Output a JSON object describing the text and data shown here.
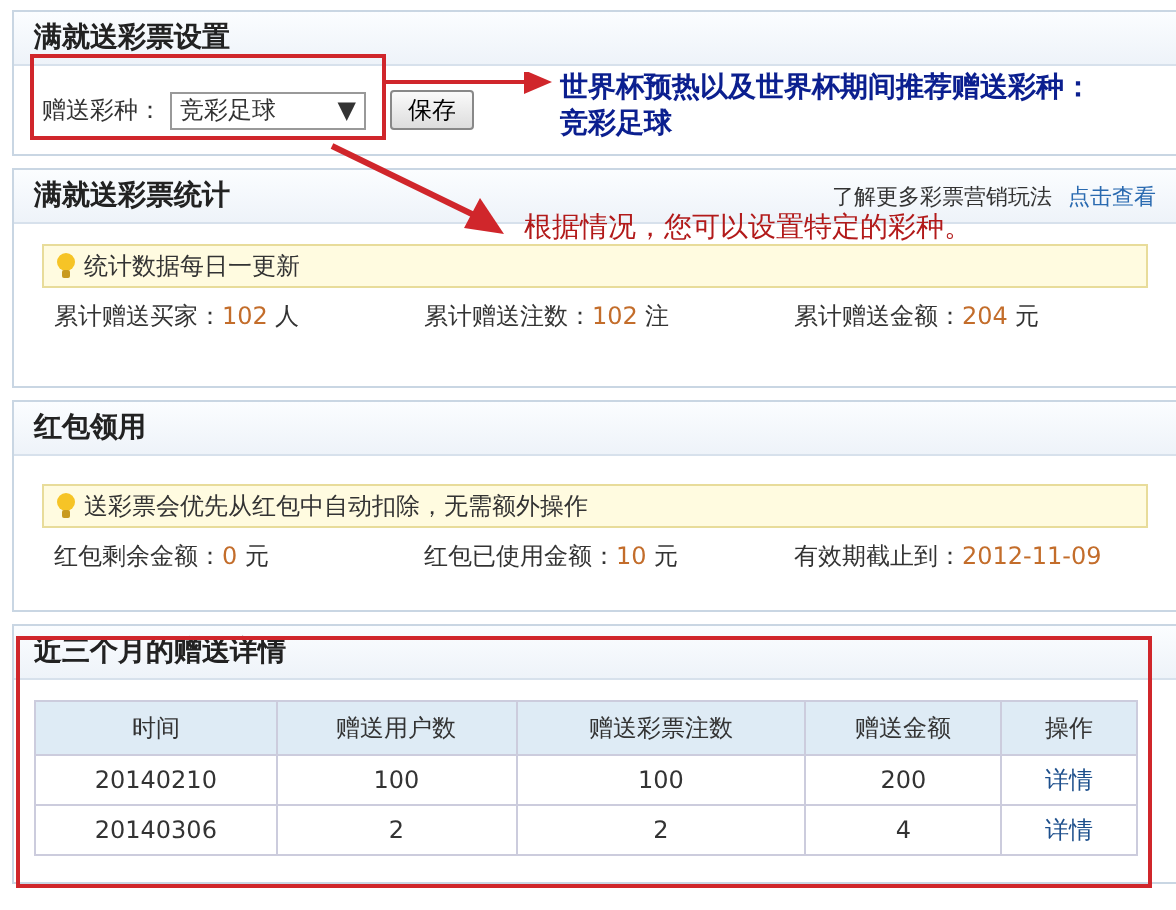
{
  "panels": [
    {
      "title": "满就送彩票设置",
      "kind": "setting",
      "field_label": "赠送彩种：",
      "select_value": "竞彩足球",
      "select_caret": "▼",
      "button": "保存"
    },
    {
      "title": "满就送彩票统计",
      "kind": "stats",
      "link_prefix": "了解更多彩票营销玩法",
      "link": "点击查看",
      "tip": "统计数据每日一更新",
      "stats": [
        {
          "label": "累计赠送买家：",
          "value": "102",
          "unit": "人"
        },
        {
          "label": "累计赠送注数：",
          "value": "102",
          "unit": "注"
        },
        {
          "label": "累计赠送金额：",
          "value": "204",
          "unit": "元"
        }
      ]
    },
    {
      "title": "红包领用",
      "kind": "stats",
      "tip": "送彩票会优先从红包中自动扣除，无需额外操作",
      "stats": [
        {
          "label": "红包剩余金额：",
          "value": "0",
          "unit": "元"
        },
        {
          "label": "红包已使用金额：",
          "value": "10",
          "unit": "元"
        },
        {
          "label": "有效期截止到：",
          "value": "2012-11-09"
        }
      ]
    },
    {
      "title": "近三个月的赠送详情",
      "kind": "table",
      "highlighted": true,
      "columns": [
        "时间",
        "赠送用户数",
        "赠送彩票注数",
        "赠送金额",
        "操作"
      ],
      "rows": [
        {
          "cells": [
            "20140210",
            "100",
            "100",
            "200"
          ],
          "action": "详情"
        },
        {
          "cells": [
            "20140306",
            "2",
            "2",
            "4"
          ],
          "action": "详情"
        }
      ]
    }
  ],
  "annotations": [
    {
      "kind": "note",
      "color": "#0b1f8f",
      "text": "世界杯预热以及世界杯期间推荐赠送彩种：竞彩足球"
    },
    {
      "kind": "note",
      "color": "#b21a1a",
      "text": "根据情况，您可以设置特定的彩种。"
    }
  ]
}
